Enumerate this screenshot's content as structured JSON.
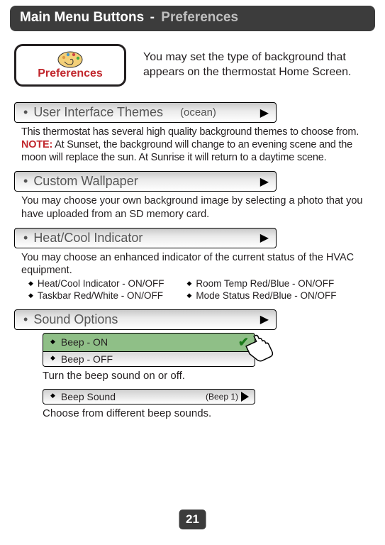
{
  "header": {
    "title_main": "Main Menu Buttons",
    "title_sep": " - ",
    "title_sub": "Preferences"
  },
  "pref_button": {
    "label": "Preferences",
    "icon_name": "palette-icon"
  },
  "intro_text": "You may set the type of background that appears on the thermostat Home Screen.",
  "themes": {
    "label": "User Interface Themes",
    "value": "(ocean)",
    "desc_line1": "This thermostat has several high quality background themes to choose from.",
    "note_label": "NOTE:",
    "desc_note": " At Sunset, the background will change to an evening scene and the moon will replace the sun.  At Sunrise it will return to a daytime scene."
  },
  "wallpaper": {
    "label": "Custom Wallpaper",
    "desc": "You may choose your own background image by selecting a photo that you have uploaded from an SD memory card."
  },
  "indicator": {
    "label": "Heat/Cool Indicator",
    "desc": "You may choose an enhanced indicator of the current status of the HVAC equipment.",
    "bullets_left": [
      "Heat/Cool Indicator - ON/OFF",
      "Taskbar Red/White - ON/OFF"
    ],
    "bullets_right": [
      "Room Temp Red/Blue - ON/OFF",
      "Mode Status Red/Blue - ON/OFF"
    ]
  },
  "sound": {
    "label": "Sound Options",
    "beep_on": "Beep - ON",
    "beep_off": "Beep - OFF",
    "beep_desc": "Turn the beep sound on or off.",
    "beep_sound_label": "Beep Sound",
    "beep_sound_value": "(Beep 1)",
    "beep_sound_desc": "Choose from different beep sounds."
  },
  "page_number": "21"
}
